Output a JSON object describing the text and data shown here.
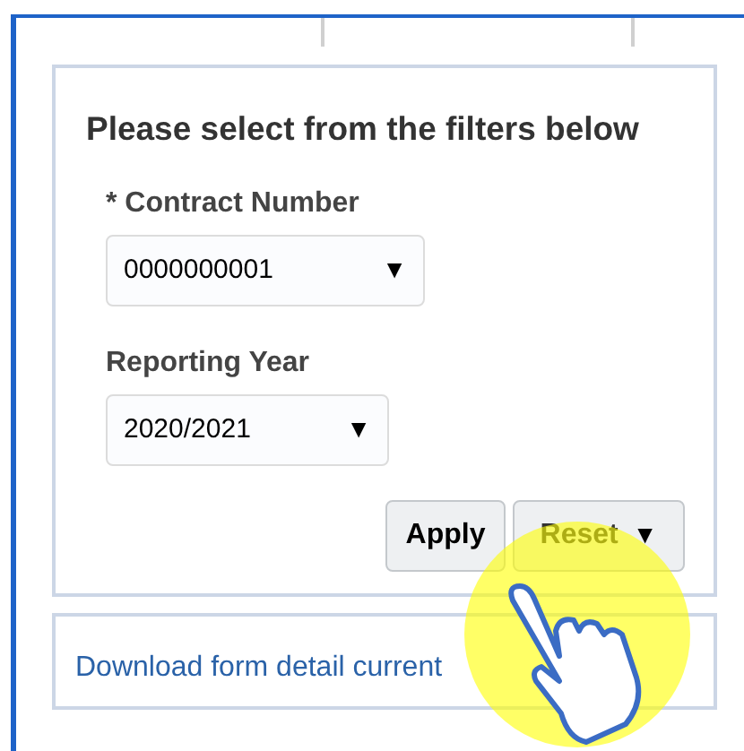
{
  "filters_panel": {
    "title": "Please select from the filters below",
    "fields": [
      {
        "label": "* Contract Number",
        "value": "0000000001",
        "arrow": "▼"
      },
      {
        "label": "Reporting Year",
        "value": "2020/2021",
        "arrow": "▼"
      }
    ],
    "buttons": [
      {
        "label": "Apply",
        "kind": "plain"
      },
      {
        "label": "Reset",
        "kind": "menu",
        "arrow": "▼"
      }
    ]
  },
  "download_panel": {
    "link": "Download form detail current"
  }
}
